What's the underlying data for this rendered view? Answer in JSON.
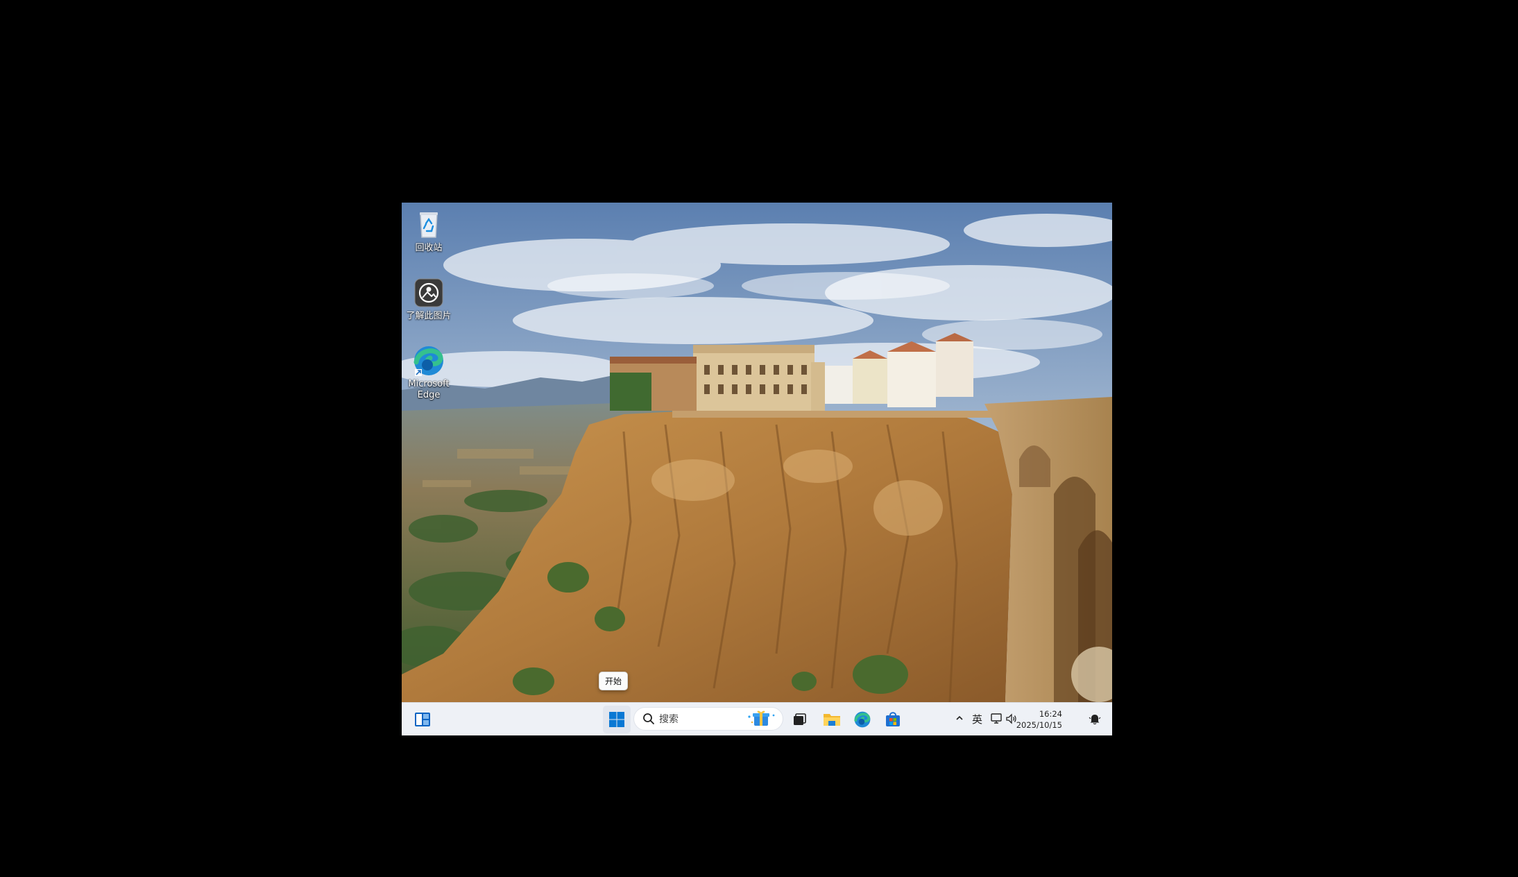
{
  "desktop": {
    "icons": [
      {
        "name": "recycle-bin",
        "label": "回收站"
      },
      {
        "name": "learn-about-picture",
        "label": "了解此图片"
      },
      {
        "name": "microsoft-edge",
        "label": "Microsoft Edge"
      }
    ]
  },
  "tooltip": {
    "text": "开始"
  },
  "taskbar": {
    "search_placeholder": "搜索",
    "apps": [
      "widgets",
      "start",
      "search",
      "task-view",
      "file-explorer",
      "microsoft-edge",
      "microsoft-store"
    ],
    "tray": {
      "ime_label": "英",
      "time": "16:24",
      "date": "2025/10/15"
    }
  },
  "colors": {
    "taskbar_bg": "#eef1f6",
    "windows_blue": "#0a78d4",
    "edge_blue": "#1f8ad6",
    "edge_green": "#34c08e"
  }
}
